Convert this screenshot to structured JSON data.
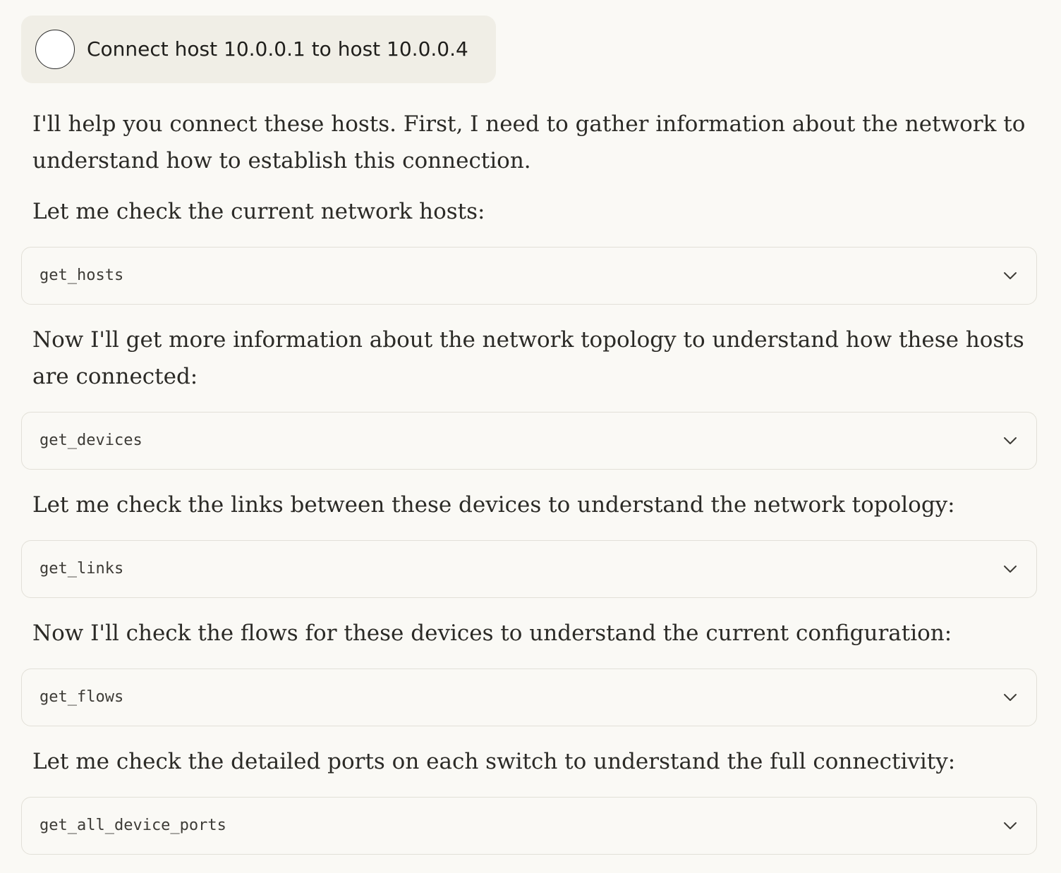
{
  "user_message": {
    "text": "Connect host 10.0.0.1 to host 10.0.0.4"
  },
  "assistant": {
    "intro": "I'll help you connect these hosts. First, I need to gather information about the network to understand how to establish this connection.",
    "step1_text": "Let me check the current network hosts:",
    "step1_tool": "get_hosts",
    "step2_text": "Now I'll get more information about the network topology to understand how these hosts are connected:",
    "step2_tool": "get_devices",
    "step3_text": "Let me check the links between these devices to understand the network topology:",
    "step3_tool": "get_links",
    "step4_text": "Now I'll check the flows for these devices to understand the current configuration:",
    "step4_tool": "get_flows",
    "step5_text": "Let me check the detailed ports on each switch to understand the full connectivity:",
    "step5_tool": "get_all_device_ports"
  },
  "icons": {
    "expand": "chevron-down-icon",
    "avatar": "user-avatar"
  }
}
